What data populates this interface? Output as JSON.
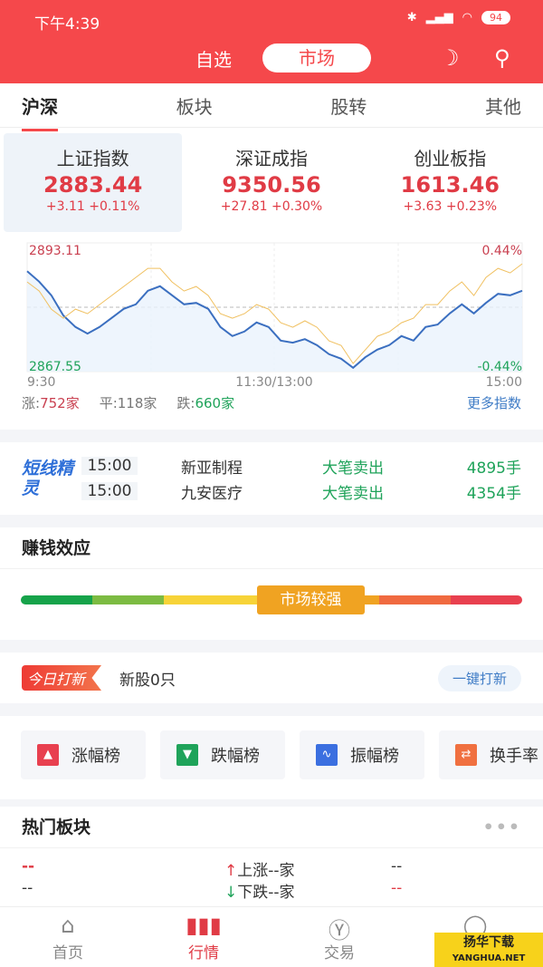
{
  "status": {
    "time": "下午4:39",
    "battery": "94"
  },
  "header": {
    "tabs": [
      "自选",
      "市场"
    ],
    "active": "市场",
    "icons": [
      "moon-icon",
      "search-icon"
    ]
  },
  "tabs": [
    "沪深",
    "板块",
    "股转",
    "其他"
  ],
  "indices": [
    {
      "name": "上证指数",
      "value": "2883.44",
      "change": "+3.11  +0.11%"
    },
    {
      "name": "深证成指",
      "value": "9350.56",
      "change": "+27.81  +0.30%"
    },
    {
      "name": "创业板指",
      "value": "1613.46",
      "change": "+3.63  +0.23%"
    }
  ],
  "chart_data": {
    "type": "line",
    "ymax_label": "2893.11",
    "ymin_label": "2867.55",
    "pmax_label": "0.44%",
    "pmin_label": "-0.44%",
    "ylim": [
      2867.55,
      2893.11
    ],
    "pct_lim": [
      -0.44,
      0.44
    ],
    "x_ticks": [
      "9:30",
      "11:30/13:00",
      "15:00"
    ],
    "series": [
      {
        "color": "#3b6fc0",
        "values": [
          2887.5,
          2885.4,
          2882.7,
          2878.7,
          2876.4,
          2875.1,
          2876.4,
          2878.2,
          2880.0,
          2880.9,
          2883.6,
          2884.5,
          2882.7,
          2880.9,
          2881.2,
          2880.0,
          2876.4,
          2874.6,
          2875.5,
          2877.3,
          2876.4,
          2873.7,
          2873.3,
          2874.0,
          2872.8,
          2871.0,
          2870.1,
          2868.3,
          2870.4,
          2871.9,
          2872.8,
          2874.6,
          2873.7,
          2876.4,
          2876.9,
          2879.1,
          2880.9,
          2879.1,
          2881.2,
          2883.0,
          2882.7,
          2883.6
        ]
      },
      {
        "color": "#f0c060",
        "unit": "percent",
        "values": [
          0.173,
          0.111,
          -0.013,
          -0.075,
          -0.013,
          -0.044,
          0.018,
          0.08,
          0.142,
          0.204,
          0.266,
          0.266,
          0.173,
          0.111,
          0.142,
          0.08,
          -0.044,
          -0.075,
          -0.044,
          0.018,
          -0.013,
          -0.106,
          -0.137,
          -0.093,
          -0.137,
          -0.23,
          -0.261,
          -0.385,
          -0.292,
          -0.199,
          -0.168,
          -0.106,
          -0.075,
          0.018,
          0.018,
          0.111,
          0.173,
          0.08,
          0.204,
          0.266,
          0.235,
          0.297
        ]
      }
    ]
  },
  "breadth": {
    "up_label": "涨:",
    "up": "752家",
    "flat_label": "平:",
    "flat": "118家",
    "down_label": "跌:",
    "down": "660家",
    "more": "更多指数"
  },
  "sprite": {
    "logo": "短线精灵",
    "rows": [
      {
        "time": "15:00",
        "stock": "新亚制程",
        "action": "大笔卖出",
        "qty": "4895手"
      },
      {
        "time": "15:00",
        "stock": "九安医疗",
        "action": "大笔卖出",
        "qty": "4354手"
      }
    ]
  },
  "money": {
    "title": "赚钱效应",
    "level": "市场较强",
    "colors": [
      "#16a34a",
      "#7cbb42",
      "#f7d338",
      "#f7d338",
      "#f0a322",
      "#f06a40",
      "#e8404f"
    ]
  },
  "ipo": {
    "tag": "今日打新",
    "text": "新股0只",
    "button": "一键打新"
  },
  "ranks": [
    {
      "label": "涨幅榜",
      "color": "#e8404f",
      "icon": "bar-up-icon"
    },
    {
      "label": "跌幅榜",
      "color": "#1fa35a",
      "icon": "bar-down-icon"
    },
    {
      "label": "振幅榜",
      "color": "#3b6fe0",
      "icon": "wave-icon"
    },
    {
      "label": "换手率",
      "color": "#f07040",
      "icon": "swap-icon"
    }
  ],
  "hot": {
    "title": "热门板块",
    "left1": "--",
    "left2": "--",
    "up": "上涨--家",
    "down": "下跌--家",
    "right1": "--",
    "right2": "--"
  },
  "nav": [
    {
      "label": "首页",
      "icon": "home-icon"
    },
    {
      "label": "行情",
      "icon": "chart-icon"
    },
    {
      "label": "交易",
      "icon": "yen-icon"
    },
    {
      "label": "",
      "icon": "user-icon"
    }
  ],
  "watermark": {
    "cn": "扬华下载",
    "en": "YANGHUA.NET"
  }
}
